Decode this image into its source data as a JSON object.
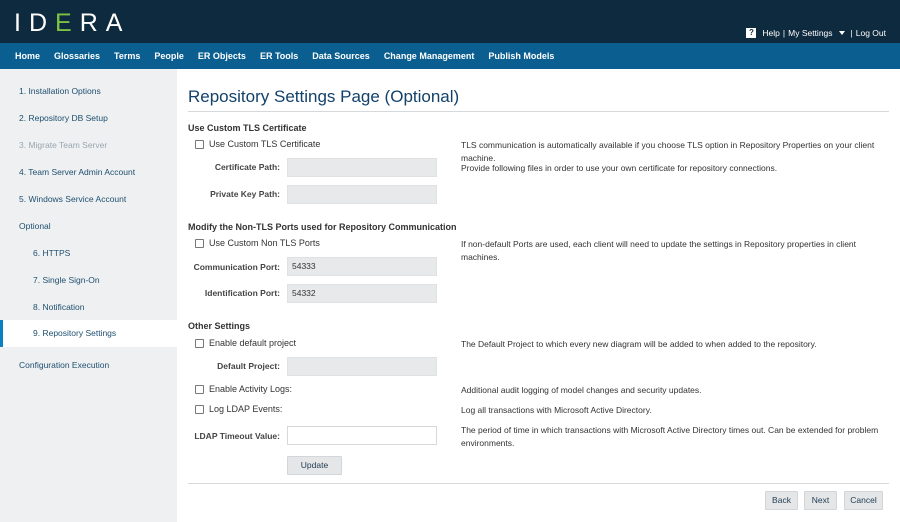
{
  "app": {
    "logo": {
      "main": "ID",
      "accent": "E",
      "rest": "RA"
    },
    "top_links": {
      "help": "Help",
      "sep1": "|",
      "my_settings": "My Settings",
      "sep2": "|",
      "logout": "Log Out"
    }
  },
  "nav": {
    "items": [
      "Home",
      "Glossaries",
      "Terms",
      "People",
      "ER Objects",
      "ER Tools",
      "Data Sources",
      "Change Management",
      "Publish Models"
    ]
  },
  "sidebar": {
    "items": [
      {
        "label": "1. Installation Options",
        "state": "normal"
      },
      {
        "label": "2. Repository DB Setup",
        "state": "normal"
      },
      {
        "label": "3. Migrate Team Server",
        "state": "disabled"
      },
      {
        "label": "4. Team Server Admin Account",
        "state": "normal"
      },
      {
        "label": "5. Windows Service Account",
        "state": "normal"
      },
      {
        "label": "Optional",
        "state": "normal"
      },
      {
        "label": "6. HTTPS",
        "state": "sub"
      },
      {
        "label": "7. Single Sign-On",
        "state": "sub"
      },
      {
        "label": "8. Notification",
        "state": "sub"
      },
      {
        "label": "9. Repository Settings",
        "state": "active"
      },
      {
        "label": "Configuration Execution",
        "state": "normal"
      }
    ]
  },
  "main": {
    "title": "Repository Settings Page (Optional)",
    "tls": {
      "section_title": "Use Custom TLS Certificate",
      "checkbox_label": "Use Custom TLS Certificate",
      "checkbox_desc": "TLS communication is automatically available if you choose TLS option in Repository Properties on your client machine.",
      "cert_label": "Certificate Path:",
      "cert_value": "",
      "cert_desc": "Provide following files in order to use your own certificate for repository connections.",
      "key_label": "Private Key Path:",
      "key_value": ""
    },
    "ports": {
      "section_title": "Modify the Non-TLS Ports used for Repository Communication",
      "checkbox_label": "Use Custom Non TLS Ports",
      "checkbox_desc": "If non-default Ports are used, each client will need to update the settings in Repository properties in client machines.",
      "comm_label": "Communication Port:",
      "comm_value": "54333",
      "ident_label": "Identification Port:",
      "ident_value": "54332"
    },
    "other": {
      "section_title": "Other Settings",
      "default_project_checkbox": "Enable default project",
      "default_project_desc": "The Default Project to which every new diagram will be added to when added to the repository.",
      "default_project_label": "Default Project:",
      "default_project_value": "",
      "activity_logs_label": "Enable Activity Logs:",
      "activity_logs_desc": "Additional audit logging of model changes and security updates.",
      "ldap_events_label": "Log LDAP Events:",
      "ldap_events_desc": "Log all transactions with Microsoft Active Directory.",
      "ldap_timeout_label": "LDAP Timeout Value:",
      "ldap_timeout_value": "",
      "ldap_timeout_desc": "The period of time in which transactions with Microsoft Active Directory times out. Can be extended for problem environments.",
      "update_label": "Update"
    },
    "footer": {
      "back": "Back",
      "next": "Next",
      "cancel": "Cancel"
    }
  }
}
